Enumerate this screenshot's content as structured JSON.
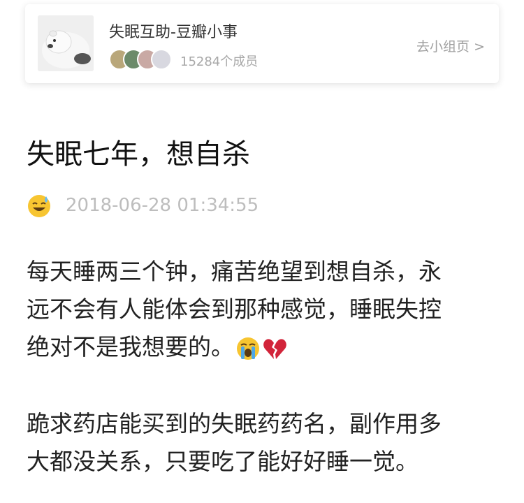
{
  "group": {
    "name": "失眠互助-豆瓣小事",
    "member_count": "15284个成员",
    "link_label": "去小组页 >",
    "member_avatar_colors": [
      "#b9a77a",
      "#6c8a6a",
      "#c9a9a4",
      "#d8d8e0"
    ]
  },
  "post": {
    "title": "失眠七年，想自杀",
    "author_avatar": "sweat-smile-emoji-icon",
    "timestamp": "2018-06-28 01:34:55",
    "paragraph1": {
      "line1": "每天睡两三个钟，痛苦绝望到想自杀，永",
      "line2": "远不会有人能体会到那种感觉，睡眠失控",
      "line3": "绝对不是我想要的。",
      "emojis": [
        "crying-face-emoji-icon",
        "broken-heart-emoji-icon"
      ]
    },
    "paragraph2": {
      "line1": "跪求药店能买到的失眠药药名，副作用多",
      "line2": "大都没关系，只要吃了能好好睡一觉。"
    }
  }
}
